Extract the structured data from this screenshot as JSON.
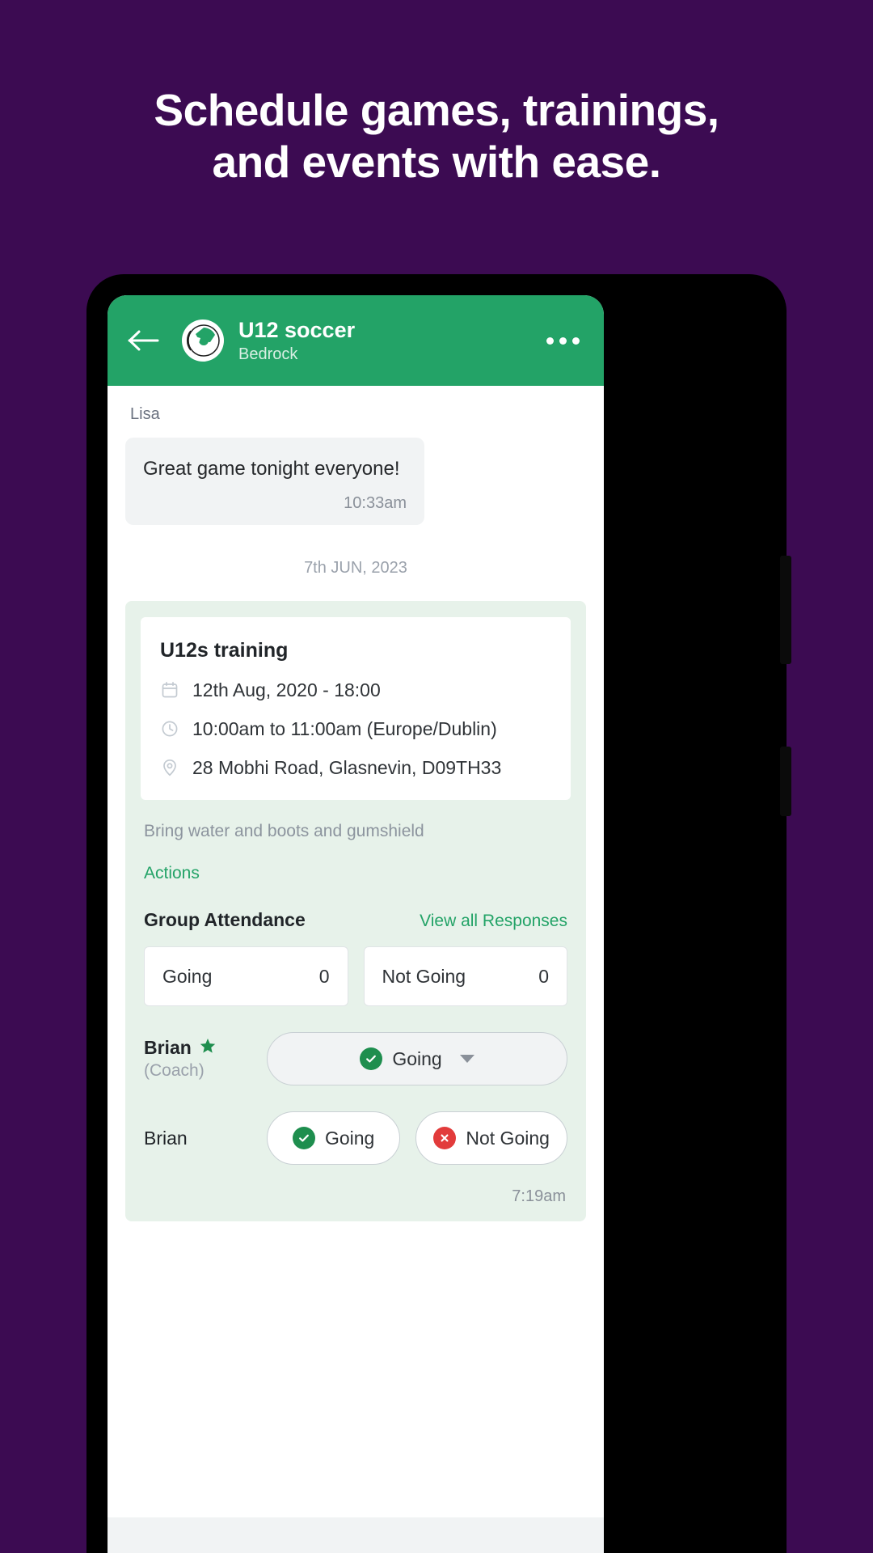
{
  "promo": {
    "headline_line1": "Schedule games, trainings,",
    "headline_line2": "and events with ease.",
    "background_color": "#3C0B52"
  },
  "app_bar": {
    "back_icon": "back-arrow-icon",
    "avatar_icon": "soccer-ball-icon",
    "title": "U12 soccer",
    "subtitle": "Bedrock",
    "overflow_icon": "more-options-icon",
    "background_color": "#23A367"
  },
  "chat": {
    "message": {
      "sender": "Lisa",
      "text": "Great game tonight everyone!",
      "time": "10:33am"
    },
    "date_divider": "7th JUN, 2023"
  },
  "event_card": {
    "title": "U12s training",
    "details": [
      {
        "icon": "calendar-icon",
        "text": "12th Aug, 2020 - 18:00"
      },
      {
        "icon": "clock-icon",
        "text": "10:00am to 11:00am (Europe/Dublin)"
      },
      {
        "icon": "location-pin-icon",
        "text": "28 Mobhi Road, Glasnevin, D09TH33"
      }
    ],
    "note": "Bring water and boots and gumshield",
    "actions_label": "Actions",
    "attendance": {
      "title": "Group Attendance",
      "view_all_label": "View all Responses",
      "tallies": [
        {
          "label": "Going",
          "count": "0"
        },
        {
          "label": "Not Going",
          "count": "0"
        }
      ],
      "members": [
        {
          "name": "Brian",
          "star_icon": "star-icon",
          "role": "(Coach)",
          "control": "dropdown",
          "selected_label": "Going",
          "selected_icon": "check-circle-icon",
          "caret_icon": "chevron-down-icon"
        },
        {
          "name": "Brian",
          "role": "",
          "control": "buttons",
          "going_label": "Going",
          "going_icon": "check-circle-icon",
          "not_going_label": "Not Going",
          "not_going_icon": "x-circle-icon"
        }
      ]
    },
    "time": "7:19am",
    "accent_color": "#23A367",
    "card_background": "#E7F2EA"
  }
}
